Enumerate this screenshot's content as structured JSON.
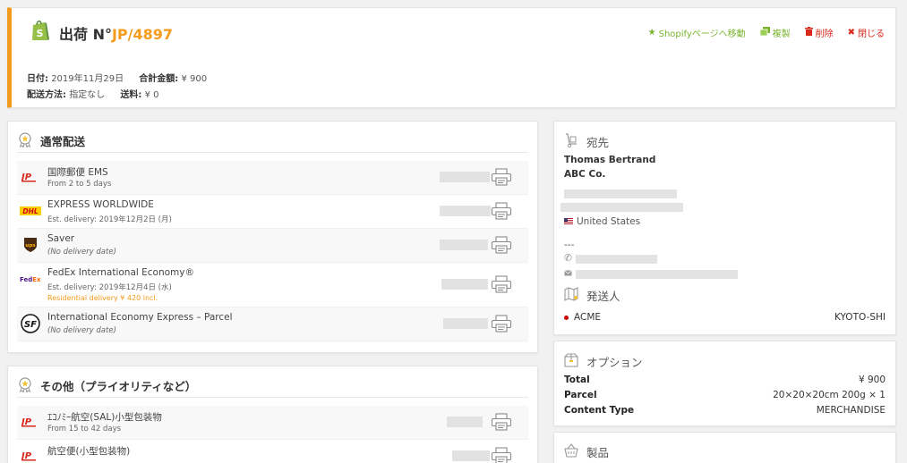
{
  "header": {
    "title_prefix": "出荷 N°",
    "order_number": "JP/4897",
    "actions": {
      "shopify": "Shopifyページへ移動",
      "duplicate": "複製",
      "delete": "削除",
      "close": "閉じる"
    },
    "date_label": "日付:",
    "date_value": "2019年11月29日",
    "total_label": "合計金額:",
    "total_value": "¥ 900",
    "method_label": "配送方法:",
    "method_value": "指定なし",
    "shipping_label": "送料:",
    "shipping_value": "¥ 0"
  },
  "standard": {
    "title": "通常配送",
    "rows": [
      {
        "carrier": "Japan Post",
        "name": "国際郵便 EMS",
        "sub": "From 2 to 5 days",
        "italic": false,
        "note": ""
      },
      {
        "carrier": "DHL",
        "name": "EXPRESS WORLDWIDE",
        "sub": "Est. delivery: 2019年12月2日 (月)",
        "italic": false,
        "note": ""
      },
      {
        "carrier": "UPS",
        "name": "Saver",
        "sub": "(No delivery date)",
        "italic": true,
        "note": ""
      },
      {
        "carrier": "FedEx",
        "name": "FedEx International Economy®",
        "sub": "Est. delivery: 2019年12月4日 (水)",
        "italic": false,
        "note": "Residential delivery ¥ 420 incl."
      },
      {
        "carrier": "SF Express",
        "name": "International Economy Express – Parcel",
        "sub": "(No delivery date)",
        "italic": true,
        "note": ""
      }
    ]
  },
  "other": {
    "title": "その他（プライオリティなど）",
    "rows": [
      {
        "carrier": "Japan Post",
        "name": "ｴｺﾉﾐｰ航空(SAL)小型包装物",
        "sub": "From 15 to 42 days",
        "italic": false,
        "note": ""
      },
      {
        "carrier": "Japan Post",
        "name": "航空便(小型包装物)",
        "sub": "",
        "italic": false,
        "note": ""
      }
    ]
  },
  "destination": {
    "title": "宛先",
    "name": "Thomas Bertrand",
    "company": "ABC Co.",
    "country": "United States",
    "dashes": "---"
  },
  "sender": {
    "title": "発送人",
    "name": "ACME",
    "city": "KYOTO-SHI"
  },
  "options": {
    "title": "オプション",
    "items": [
      {
        "key": "Total",
        "value": "¥ 900"
      },
      {
        "key": "Parcel",
        "value": "20×20×20cm 200g × 1"
      },
      {
        "key": "Content Type",
        "value": "MERCHANDISE"
      }
    ]
  },
  "products": {
    "title": "製品"
  },
  "colors": {
    "accent": "#f49b1c",
    "green": "#7ab32e",
    "red": "#d9271a"
  }
}
